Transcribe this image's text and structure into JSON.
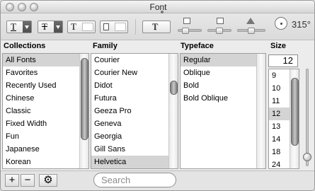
{
  "window": {
    "title": "Font"
  },
  "toolbar": {
    "underline_glyph": "T",
    "strike_glyph": "T",
    "color_glyph": "T",
    "shadow_glyph": "T",
    "rotation_value": "315°"
  },
  "headers": {
    "collections": "Collections",
    "family": "Family",
    "typeface": "Typeface",
    "size": "Size"
  },
  "collections": {
    "items": [
      "All Fonts",
      "Favorites",
      "Recently Used",
      "Chinese",
      "Classic",
      "Fixed Width",
      "Fun",
      "Japanese",
      "Korean"
    ],
    "selected": "All Fonts"
  },
  "family": {
    "items": [
      "Courier",
      "Courier New",
      "Didot",
      "Futura",
      "Geeza Pro",
      "Geneva",
      "Georgia",
      "Gill Sans",
      "Helvetica"
    ],
    "selected": "Helvetica"
  },
  "typeface": {
    "items": [
      "Regular",
      "Oblique",
      "Bold",
      "Bold Oblique"
    ],
    "selected": "Regular"
  },
  "size": {
    "value": "12",
    "items": [
      "9",
      "10",
      "11",
      "12",
      "13",
      "14",
      "18",
      "24"
    ],
    "selected": "12"
  },
  "bottom": {
    "add_label": "+",
    "remove_label": "−",
    "gear_label": "⚙",
    "search_placeholder": "Search"
  }
}
